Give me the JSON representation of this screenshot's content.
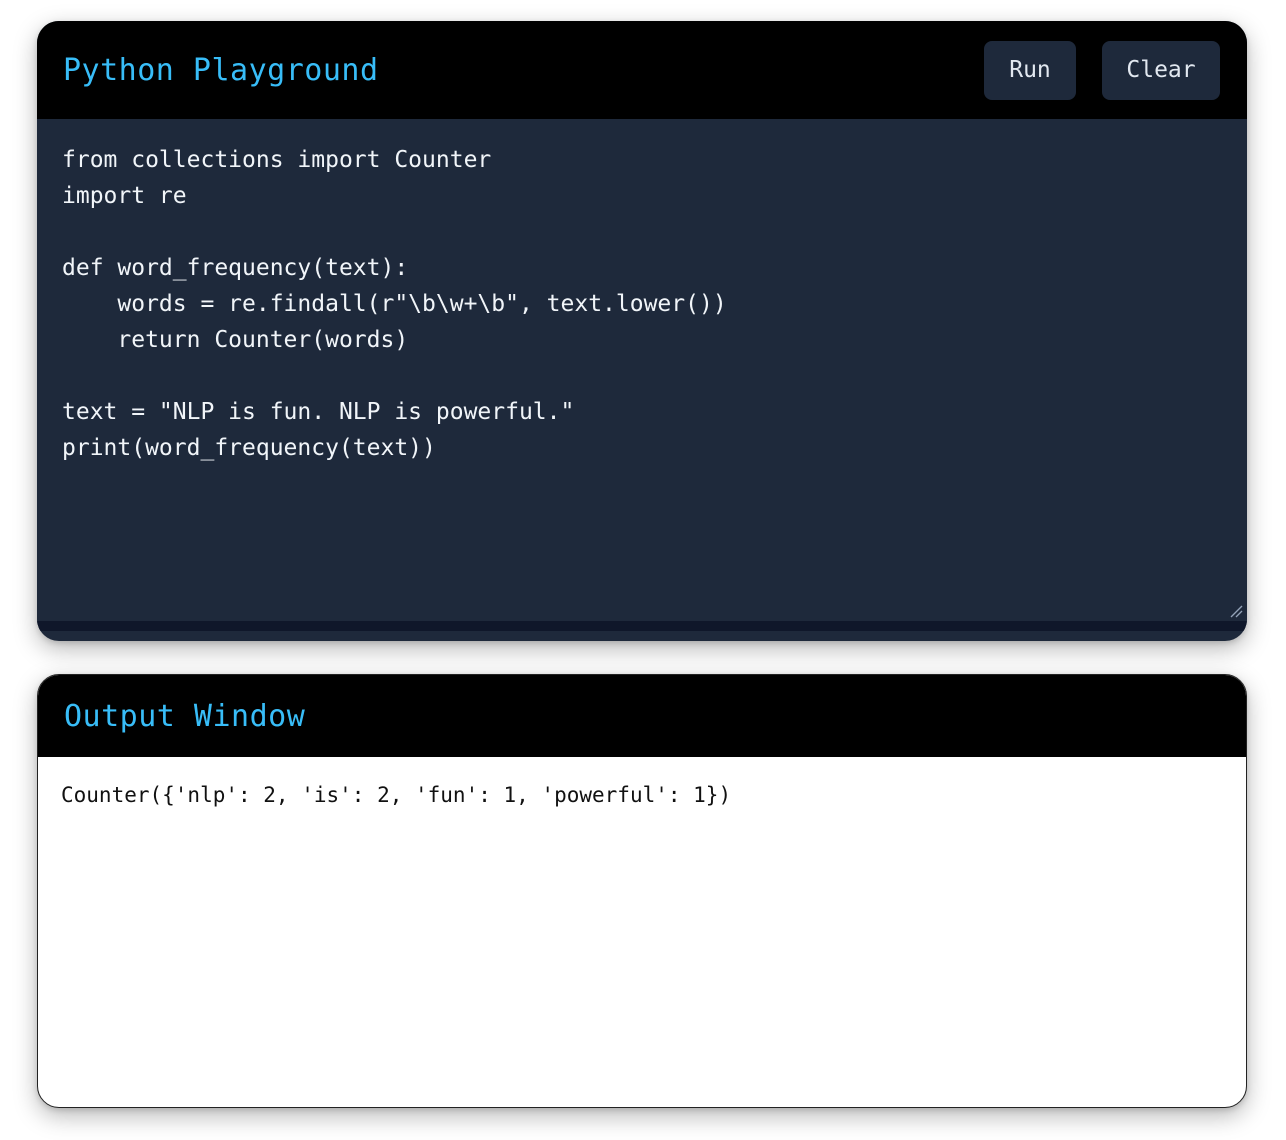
{
  "editor": {
    "title": "Python Playground",
    "run_label": "Run",
    "clear_label": "Clear",
    "code": "from collections import Counter\nimport re\n\ndef word_frequency(text):\n    words = re.findall(r\"\\b\\w+\\b\", text.lower())\n    return Counter(words)\n\ntext = \"NLP is fun. NLP is powerful.\"\nprint(word_frequency(text))"
  },
  "output": {
    "title": "Output Window",
    "text": "Counter({'nlp': 2, 'is': 2, 'fun': 1, 'powerful': 1})"
  },
  "colors": {
    "accent": "#38bdf8",
    "editor_bg": "#1e293b",
    "header_bg": "#000000"
  },
  "icons": {
    "resize": "resize-grip-icon"
  }
}
